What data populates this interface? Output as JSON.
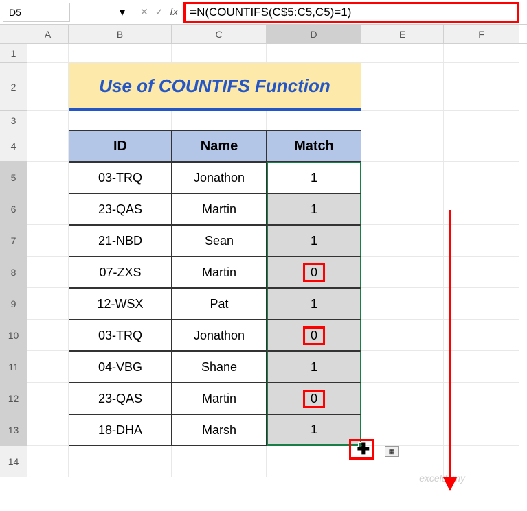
{
  "name_box": "D5",
  "formula": "=N(COUNTIFS(C$5:C5,C5)=1)",
  "columns": [
    "A",
    "B",
    "C",
    "D",
    "E",
    "F"
  ],
  "rows": [
    "1",
    "2",
    "3",
    "4",
    "5",
    "6",
    "7",
    "8",
    "9",
    "10",
    "11",
    "12",
    "13",
    "14"
  ],
  "title": "Use of COUNTIFS Function",
  "headers": {
    "id": "ID",
    "name": "Name",
    "match": "Match"
  },
  "table": [
    {
      "id": "03-TRQ",
      "name": "Jonathon",
      "match": "1"
    },
    {
      "id": "23-QAS",
      "name": "Martin",
      "match": "1"
    },
    {
      "id": "21-NBD",
      "name": "Sean",
      "match": "1"
    },
    {
      "id": "07-ZXS",
      "name": "Martin",
      "match": "0"
    },
    {
      "id": "12-WSX",
      "name": "Pat",
      "match": "1"
    },
    {
      "id": "03-TRQ",
      "name": "Jonathon",
      "match": "0"
    },
    {
      "id": "04-VBG",
      "name": "Shane",
      "match": "1"
    },
    {
      "id": "23-QAS",
      "name": "Martin",
      "match": "0"
    },
    {
      "id": "18-DHA",
      "name": "Marsh",
      "match": "1"
    }
  ],
  "watermark": "exceldemy",
  "icons": {
    "cancel": "✕",
    "check": "✓",
    "dropdown": "▾"
  }
}
